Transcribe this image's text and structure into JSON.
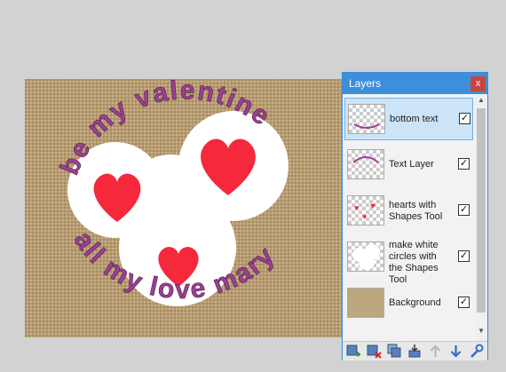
{
  "panel": {
    "title": "Layers",
    "close_label": "x"
  },
  "layers": [
    {
      "name": "bottom text",
      "visible": true,
      "selected": true
    },
    {
      "name": "Text Layer",
      "visible": true,
      "selected": false
    },
    {
      "name": "hearts with Shapes Tool",
      "visible": true,
      "selected": false
    },
    {
      "name": "make white circles with the Shapes Tool",
      "visible": true,
      "selected": false
    },
    {
      "name": "Background",
      "visible": true,
      "selected": false
    }
  ],
  "canvas": {
    "top_text": "be my valentine",
    "bottom_text": "all my love mary",
    "colors": {
      "burlap": "#b59b71",
      "heart": "#f5283c",
      "text": "#9b3f93",
      "circle": "#ffffff"
    }
  },
  "toolbar": {
    "icons": [
      "add-layer-icon",
      "delete-layer-icon",
      "duplicate-layer-icon",
      "merge-layer-down-icon",
      "move-layer-up-icon",
      "move-layer-down-icon",
      "layer-properties-icon"
    ]
  }
}
